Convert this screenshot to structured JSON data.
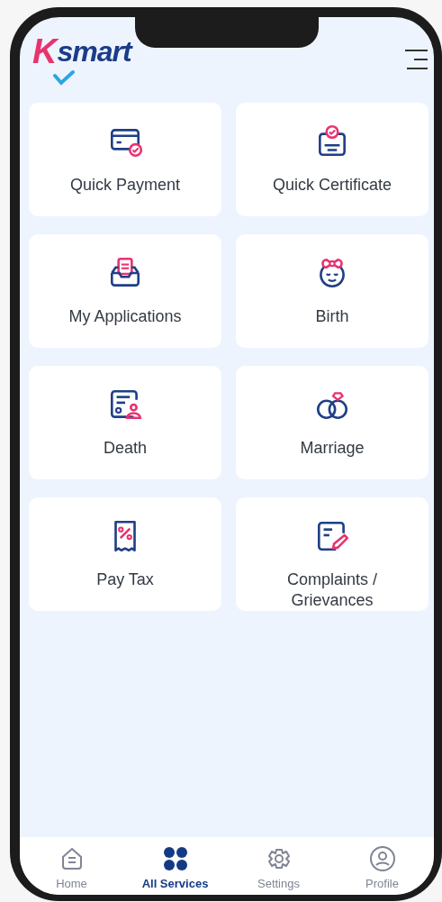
{
  "header": {
    "logo": {
      "mark": "K",
      "text": "smart"
    }
  },
  "services": [
    {
      "label": "Quick Payment"
    },
    {
      "label": "Quick Certificate"
    },
    {
      "label": "My Applications"
    },
    {
      "label": "Birth"
    },
    {
      "label": "Death"
    },
    {
      "label": "Marriage"
    },
    {
      "label": "Pay Tax"
    },
    {
      "label": "Complaints / Grievances"
    }
  ],
  "bottom_nav": [
    {
      "label": "Home",
      "selected": false
    },
    {
      "label": "All Services",
      "selected": true
    },
    {
      "label": "Settings",
      "selected": false
    },
    {
      "label": "Profile",
      "selected": false
    }
  ]
}
